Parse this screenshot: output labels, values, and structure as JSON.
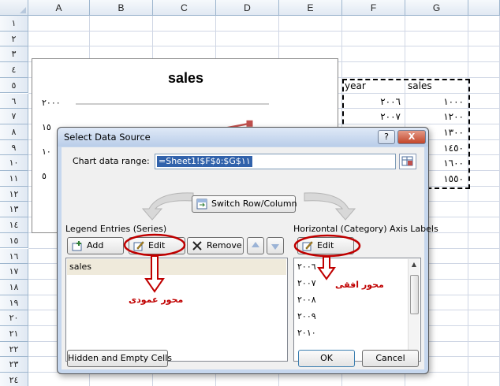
{
  "spreadsheet": {
    "columns": [
      "A",
      "B",
      "C",
      "D",
      "E",
      "F",
      "G"
    ],
    "rows": [
      "١",
      "٢",
      "٣",
      "٤",
      "٥",
      "٦",
      "٧",
      "٨",
      "٩",
      "١٠",
      "١١",
      "١٢",
      "١٣",
      "١٤",
      "١٥",
      "١٦",
      "١٧",
      "١٨",
      "١٩",
      "٢٠",
      "٢١",
      "٢٢",
      "٢٣",
      "٢٤"
    ],
    "table": {
      "headers": [
        "year",
        "sales"
      ],
      "years": [
        "٢٠٠٦",
        "٢٠٠٧",
        "٢٠٠٨",
        "٢٠٠٩",
        "٢٠١٠"
      ],
      "sales": [
        "١٠٠٠",
        "١٢٠٠",
        "١٣٠٠",
        "١٤٥٠",
        "١٦٠٠",
        "١٥٥٠"
      ]
    }
  },
  "chart": {
    "title": "sales",
    "ytick_labels": [
      "٢٠٠٠",
      "١٥",
      "١٠",
      "٥"
    ],
    "line_color": "#c0504d"
  },
  "chart_data": {
    "type": "line",
    "title": "sales",
    "x": [
      "٢٠٠٦",
      "٢٠٠٧",
      "٢٠٠٨",
      "٢٠٠٩",
      "٢٠١٠"
    ],
    "series": [
      {
        "values": [
          1000,
          1200,
          1300,
          1450,
          1600
        ]
      }
    ],
    "ylim": [
      0,
      2000
    ]
  },
  "dialog": {
    "title": "Select Data Source",
    "help_label": "?",
    "close_label": "X",
    "range_label": "Chart data range:",
    "range_value": "=Sheet1!$F$٥:$G$١١",
    "switch_label": "Switch Row/Column",
    "legend_title": "Legend Entries (Series)",
    "add_label": "Add",
    "edit_label": "Edit",
    "remove_label": "Remove",
    "series_items": [
      "sales"
    ],
    "axis_title": "Horizontal (Category) Axis Labels",
    "axis_edit_label": "Edit",
    "axis_items": [
      "٢٠٠٦",
      "٢٠٠٧",
      "٢٠٠٨",
      "٢٠٠٩",
      "٢٠١٠"
    ],
    "hidden_label": "Hidden and Empty Cells",
    "ok_label": "OK",
    "cancel_label": "Cancel"
  },
  "annotations": {
    "vertical_axis": "محور عمودی",
    "horizontal_axis": "محور افقی",
    "color": "#c00000"
  }
}
